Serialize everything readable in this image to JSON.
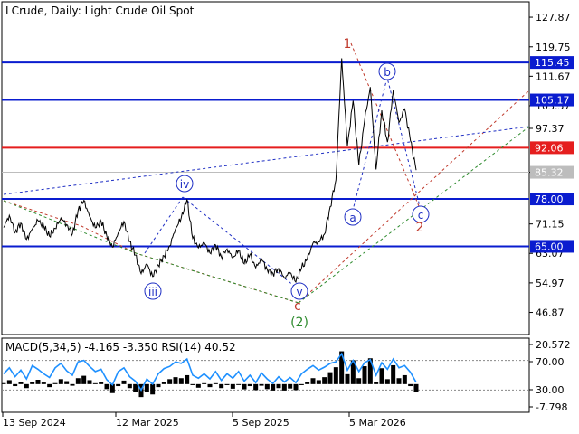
{
  "header": {
    "symbol_line": "LCrude, Daily:  Light Crude Oil Spot"
  },
  "colors": {
    "price": "#000000",
    "level_blue": "#0a1ccf",
    "level_red": "#e51e1e",
    "current_line": "#bdbdbd",
    "wave_red": "#c0392b",
    "wave_blue": "#1f2fc4",
    "wave_green": "#2e8b2e",
    "macd_line": "#1e90ff",
    "macd_hist": "#000000",
    "axis": "#000000"
  },
  "chart_data": [
    {
      "type": "line",
      "title": "LCrude, Daily:  Light Crude Oil Spot",
      "x_ticks": [
        "13 Sep 2024",
        "12 Mar 2025",
        "5 Sep 2025",
        "5 Mar 2026"
      ],
      "y_ticks": [
        "127.87",
        "119.75",
        "111.67",
        "103.57",
        "97.37",
        "85.32",
        "71.15",
        "63.07",
        "54.97",
        "46.87"
      ],
      "ylim": [
        40.8,
        132.1
      ],
      "grid": false,
      "series": [
        {
          "values": [
            70.2,
            73.5,
            68.8,
            71.4,
            66.9,
            69.7,
            72.1,
            70.5,
            67.8,
            69.9,
            72.8,
            71.0,
            68.4,
            74.9,
            77.6,
            73.2,
            70.1,
            71.9,
            67.9,
            64.8,
            68.7,
            71.8,
            66.3,
            62.6,
            57.5,
            60.2,
            56.7,
            59.8,
            62.4,
            65.2,
            69.8,
            72.8,
            77.9,
            67.2,
            64.6,
            66.0,
            63.2,
            65.4,
            62.1,
            64.3,
            61.8,
            63.9,
            60.2,
            62.7,
            59.1,
            61.6,
            58.7,
            57.6,
            58.9,
            56.4,
            57.8,
            55.2,
            59.0,
            61.5,
            65.9,
            66.2,
            68.4,
            75.9,
            83.2,
            116.6,
            92.5,
            104.9,
            87.2,
            99.5,
            108.7,
            86.1,
            102.3,
            93.6,
            107.9,
            99.0,
            102.7,
            94.0,
            85.9
          ]
        }
      ],
      "levels": [
        {
          "value": 115.45,
          "label": "115.45",
          "color": "blue"
        },
        {
          "value": 105.17,
          "label": "105.17",
          "color": "blue"
        },
        {
          "value": 92.06,
          "label": "92.06",
          "color": "red"
        },
        {
          "value": 85.32,
          "label": "85.32",
          "color": "gray"
        },
        {
          "value": 78.0,
          "label": "78.00",
          "color": "blue"
        },
        {
          "value": 65.0,
          "label": "65.00",
          "color": "blue"
        }
      ],
      "wave_labels": [
        {
          "label": "1",
          "color": "red",
          "circled": false
        },
        {
          "label": "b",
          "color": "blue",
          "circled": true
        },
        {
          "label": "iv",
          "color": "blue",
          "circled": true
        },
        {
          "label": "a",
          "color": "blue",
          "circled": true
        },
        {
          "label": "c",
          "color": "blue",
          "circled": true
        },
        {
          "label": "2",
          "color": "red",
          "circled": false
        },
        {
          "label": "iii",
          "color": "blue",
          "circled": true
        },
        {
          "label": "v",
          "color": "blue",
          "circled": true
        },
        {
          "label": "c",
          "color": "red",
          "circled": false
        },
        {
          "label": "(2)",
          "color": "green",
          "circled": false
        }
      ]
    },
    {
      "type": "area",
      "title": "MACD(5,34,5) -4.165 -3.350 RSI(14) 40.52",
      "y_ticks": [
        "20.572",
        "70.00",
        "30.00",
        "-7.798"
      ],
      "ylim": [
        -7.798,
        20.572
      ],
      "series": [
        {
          "name": "RSI(14)",
          "values": [
            52,
            60,
            48,
            57,
            45,
            63,
            58,
            52,
            47,
            60,
            66,
            56,
            50,
            68,
            70,
            62,
            55,
            58,
            44,
            37,
            55,
            60,
            48,
            42,
            30,
            45,
            38,
            52,
            59,
            62,
            68,
            66,
            72,
            50,
            46,
            52,
            45,
            55,
            43,
            52,
            46,
            55,
            42,
            50,
            40,
            53,
            45,
            39,
            48,
            41,
            47,
            40,
            52,
            58,
            63,
            57,
            61,
            66,
            68,
            79,
            57,
            70,
            55,
            67,
            71,
            50,
            67,
            58,
            72,
            60,
            63,
            54,
            40.52
          ]
        },
        {
          "name": "MACD",
          "values": [
            0.5,
            2.0,
            -1.0,
            1.2,
            -2.0,
            1.0,
            2.2,
            0.8,
            -1.5,
            0.5,
            2.5,
            1.5,
            -0.8,
            3.0,
            4.2,
            2.0,
            0.4,
            1.0,
            -2.5,
            -4.5,
            -1.0,
            1.8,
            -2.0,
            -4.0,
            -6.5,
            -4.0,
            -5.2,
            -1.5,
            1.0,
            2.5,
            3.5,
            3.0,
            4.5,
            -0.5,
            -1.8,
            0.2,
            -1.5,
            0.3,
            -2.0,
            -0.5,
            -2.3,
            -0.2,
            -2.6,
            -1.0,
            -3.0,
            -0.8,
            -2.5,
            -3.2,
            -2.0,
            -3.2,
            -2.2,
            -3.0,
            -0.5,
            1.2,
            3.0,
            2.0,
            3.5,
            6.0,
            8.5,
            16.5,
            5.0,
            12.0,
            3.0,
            9.0,
            13.0,
            1.0,
            8.0,
            2.5,
            9.5,
            3.0,
            4.5,
            -1.0,
            -4.165
          ]
        }
      ]
    }
  ]
}
